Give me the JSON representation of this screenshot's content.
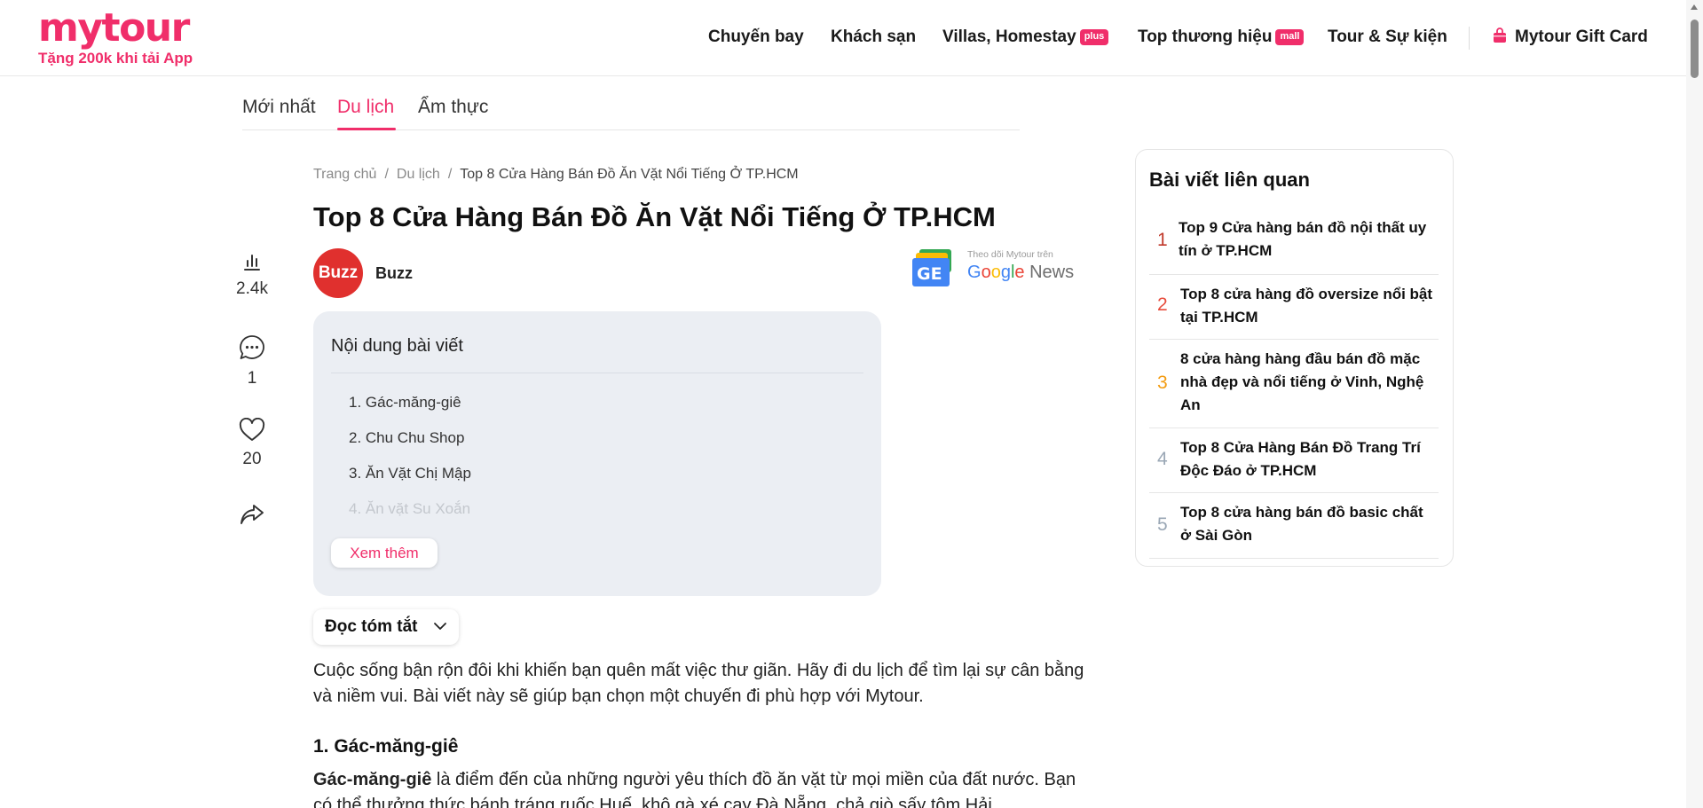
{
  "header": {
    "logo": "mytour",
    "logo_tagline": "Tặng 200k khi tải App",
    "nav": [
      {
        "label": "Chuyến bay"
      },
      {
        "label": "Khách sạn"
      },
      {
        "label": "Villas, Homestay",
        "badge": "plus"
      },
      {
        "label": "Top thương hiệu",
        "badge": "mall"
      },
      {
        "label": "Tour & Sự kiện"
      }
    ],
    "gift_card": "Mytour Gift Card"
  },
  "tabs": [
    {
      "label": "Mới nhất"
    },
    {
      "label": "Du lịch",
      "active": true
    },
    {
      "label": "Ẩm thực"
    }
  ],
  "breadcrumb": {
    "home": "Trang chủ",
    "section": "Du lịch",
    "current": "Top 8 Cửa Hàng Bán Đồ Ăn Vặt Nổi Tiếng Ở TP.HCM"
  },
  "article": {
    "title": "Top 8 Cửa Hàng Bán Đồ Ăn Vặt Nổi Tiếng Ở TP.HCM",
    "author_avatar": "Buzz",
    "author": "Buzz",
    "gnews_small": "Theo dõi Mytour trên",
    "gnews_big": "Google News",
    "intro": "Cuộc sống bận rộn đôi khi khiến bạn quên mất việc thư giãn. Hãy đi du lịch để tìm lại sự cân bằng và niềm vui. Bài viết này sẽ giúp bạn chọn một chuyến đi phù hợp với Mytour.",
    "section1_heading": "1. Gác-măng-giê",
    "section1_bold": "Gác-măng-giê",
    "section1_text": " là điểm đến của những người yêu thích đồ ăn vặt từ mọi miền của đất nước. Bạn có thể thưởng thức bánh tráng ruốc Huế, khô gà xé cay Đà Nẵng, chả giò sấy tôm Hải"
  },
  "rail": {
    "views": "2.4k",
    "comments": "1",
    "likes": "20"
  },
  "toc": {
    "title": "Nội dung bài viết",
    "items": [
      "1. Gác-măng-giê",
      "2. Chu Chu Shop",
      "3. Ăn Vặt Chị Mập",
      "4. Ăn vặt Su Xoắn"
    ],
    "more": "Xem thêm"
  },
  "summary_label": "Đọc tóm tắt",
  "related": {
    "title": "Bài viết liên quan",
    "items": [
      {
        "num": "1",
        "text": "Top 9 Cửa hàng bán đồ nội thất uy tín ở TP.HCM",
        "color": "#c0392b"
      },
      {
        "num": "2",
        "text": "Top 8 cửa hàng đồ oversize nổi bật tại TP.HCM",
        "color": "#e74c3c"
      },
      {
        "num": "3",
        "text": "8 cửa hàng hàng đầu bán đồ mặc nhà đẹp và nổi tiếng ở Vinh, Nghệ An",
        "color": "#f39c12"
      },
      {
        "num": "4",
        "text": "Top 8 Cửa Hàng Bán Đồ Trang Trí Độc Đáo ở TP.HCM",
        "color": "#9aa7b5"
      },
      {
        "num": "5",
        "text": "Top 8 cửa hàng bán đồ basic chất ở Sài Gòn",
        "color": "#9aa7b5"
      }
    ]
  },
  "colors": {
    "accent": "#f02e6a",
    "toc_bg": "#ebeef3",
    "avatar": "#e0302e"
  }
}
